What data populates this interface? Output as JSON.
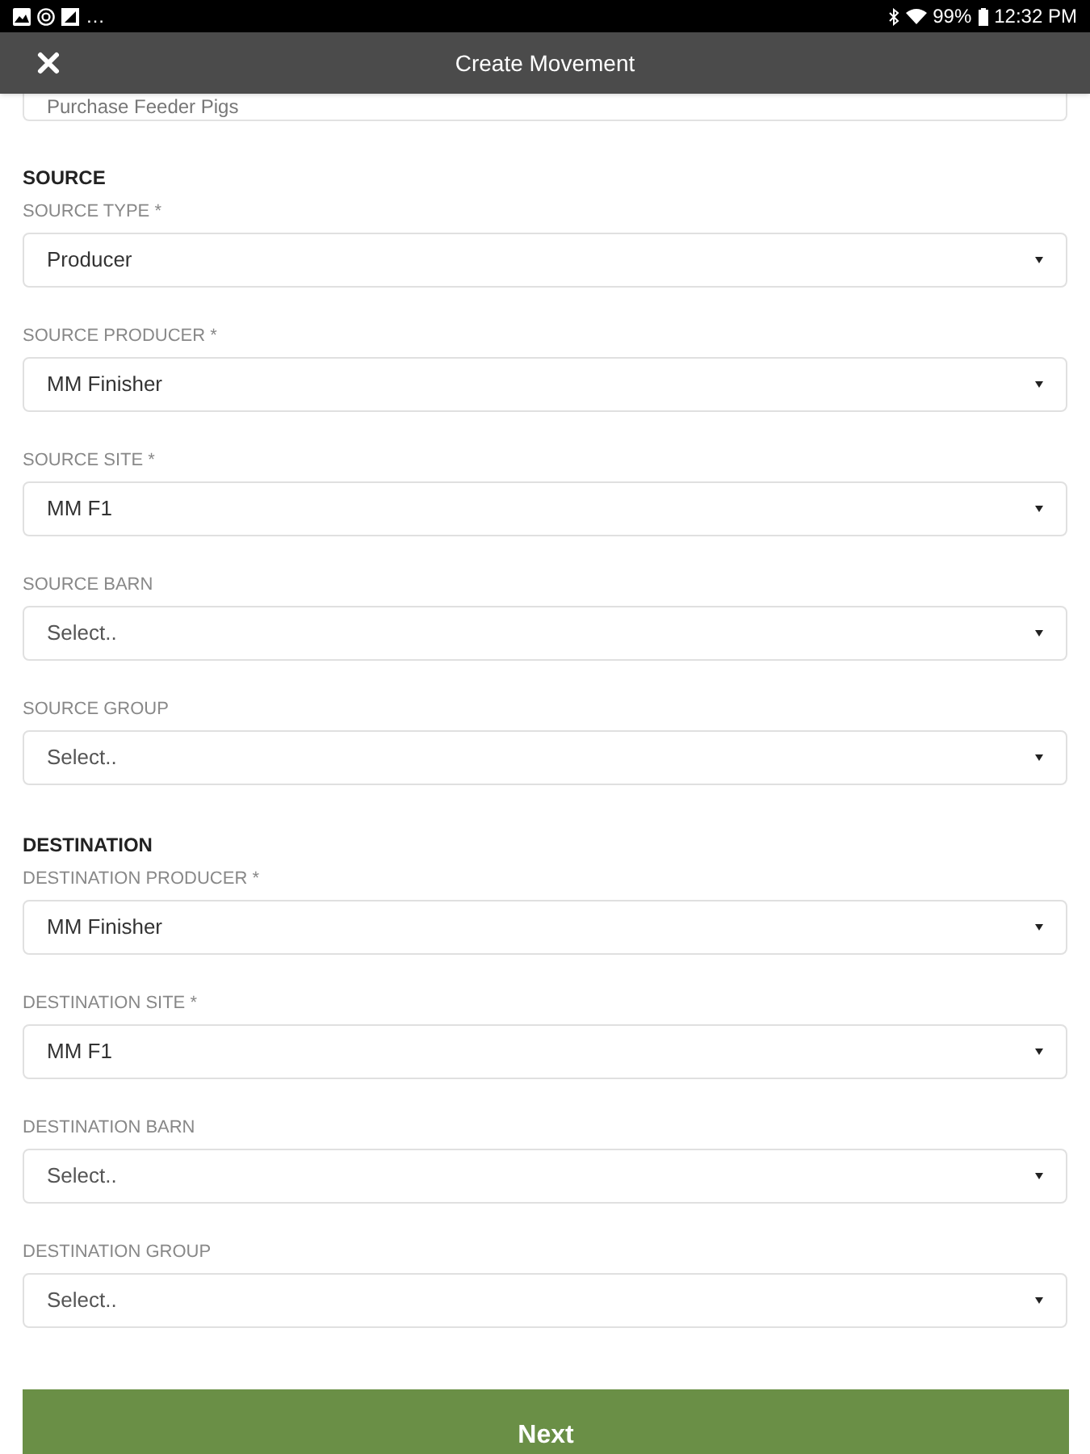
{
  "status_bar": {
    "more": "…",
    "battery": "99%",
    "time": "12:32 PM"
  },
  "header": {
    "title": "Create Movement"
  },
  "top_select": {
    "value": "Purchase Feeder Pigs"
  },
  "sections": [
    {
      "title": "SOURCE",
      "fields": [
        {
          "label": "SOURCE TYPE *",
          "value": "Producer",
          "placeholder": false
        },
        {
          "label": "SOURCE PRODUCER *",
          "value": "MM Finisher",
          "placeholder": false
        },
        {
          "label": "SOURCE SITE *",
          "value": "MM F1",
          "placeholder": false
        },
        {
          "label": "SOURCE BARN",
          "value": "Select..",
          "placeholder": true
        },
        {
          "label": "SOURCE GROUP",
          "value": "Select..",
          "placeholder": true
        }
      ]
    },
    {
      "title": "DESTINATION",
      "fields": [
        {
          "label": "DESTINATION PRODUCER *",
          "value": "MM Finisher",
          "placeholder": false
        },
        {
          "label": "DESTINATION SITE *",
          "value": "MM F1",
          "placeholder": false
        },
        {
          "label": "DESTINATION BARN",
          "value": "Select..",
          "placeholder": true
        },
        {
          "label": "DESTINATION GROUP",
          "value": "Select..",
          "placeholder": true
        }
      ]
    }
  ],
  "next_button": {
    "label": "Next"
  }
}
